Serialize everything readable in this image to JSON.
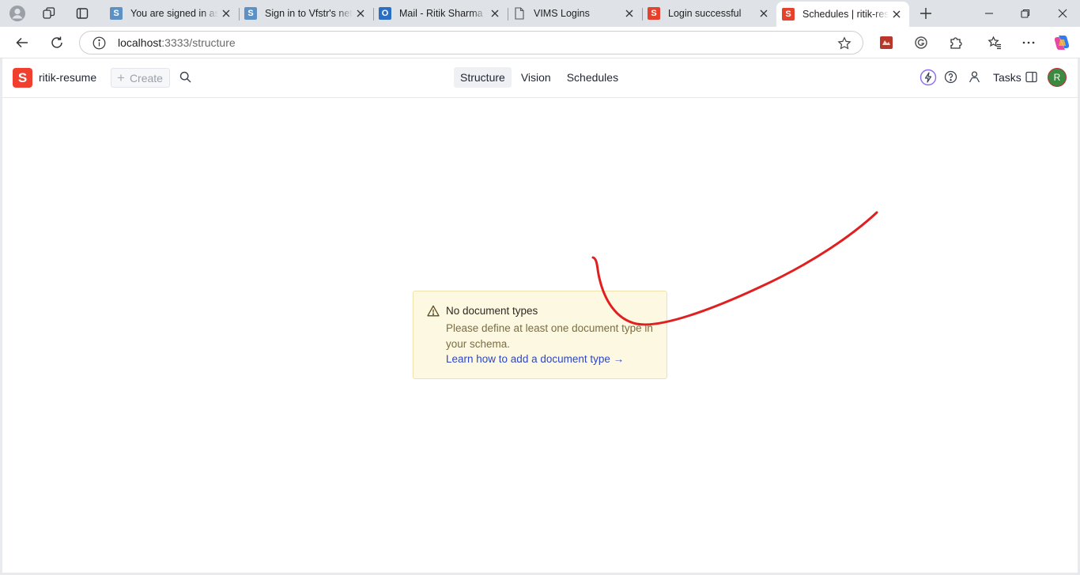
{
  "browser": {
    "tabs": [
      {
        "title": "You are signed in as",
        "favicon": "sanity-tile-icon",
        "fav_letter": "S",
        "active": false
      },
      {
        "title": "Sign in to Vfstr's network",
        "favicon": "sanity-tile-icon",
        "fav_letter": "S",
        "active": false
      },
      {
        "title": "Mail - Ritik Sharma - Outlook",
        "favicon": "outlook-icon",
        "fav_letter": "O",
        "active": false
      },
      {
        "title": "VIMS Logins",
        "favicon": "document-icon",
        "fav_letter": "",
        "active": false
      },
      {
        "title": "Login successful",
        "favicon": "sanity-red-icon",
        "fav_letter": "S",
        "active": false
      },
      {
        "title": "Schedules | ritik-resume",
        "favicon": "sanity-red-icon",
        "fav_letter": "S",
        "active": true
      }
    ],
    "address": {
      "host": "localhost",
      "rest": ":3333/structure"
    }
  },
  "app": {
    "logo_letter": "S",
    "project_name": "ritik-resume",
    "create_label": "Create",
    "nav_tabs": [
      {
        "label": "Structure",
        "current": true
      },
      {
        "label": "Vision",
        "current": false
      },
      {
        "label": "Schedules",
        "current": false
      }
    ],
    "tasks_label": "Tasks",
    "avatar_initial": "R"
  },
  "notice": {
    "title": "No document types",
    "description": "Please define at least one document type in your schema.",
    "link_text": "Learn how to add a document type →"
  },
  "colors": {
    "brand": "#f03e2f",
    "warning_bg": "#fdf8e2",
    "link": "#2c46c7",
    "annotation": "#e02020"
  }
}
